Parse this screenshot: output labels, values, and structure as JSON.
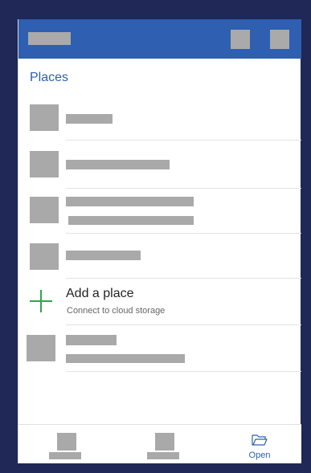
{
  "places_heading": "Places",
  "add_place": {
    "title": "Add a place",
    "subtitle": "Connect to cloud storage"
  },
  "bottom_nav": {
    "open_label": "Open",
    "open_icon": "folder-open-icon"
  },
  "colors": {
    "background": "#1f2857",
    "header": "#2e5fb0",
    "accent": "#2e5fb0",
    "plus": "#2ea44f",
    "placeholder": "#a9a9a9"
  }
}
